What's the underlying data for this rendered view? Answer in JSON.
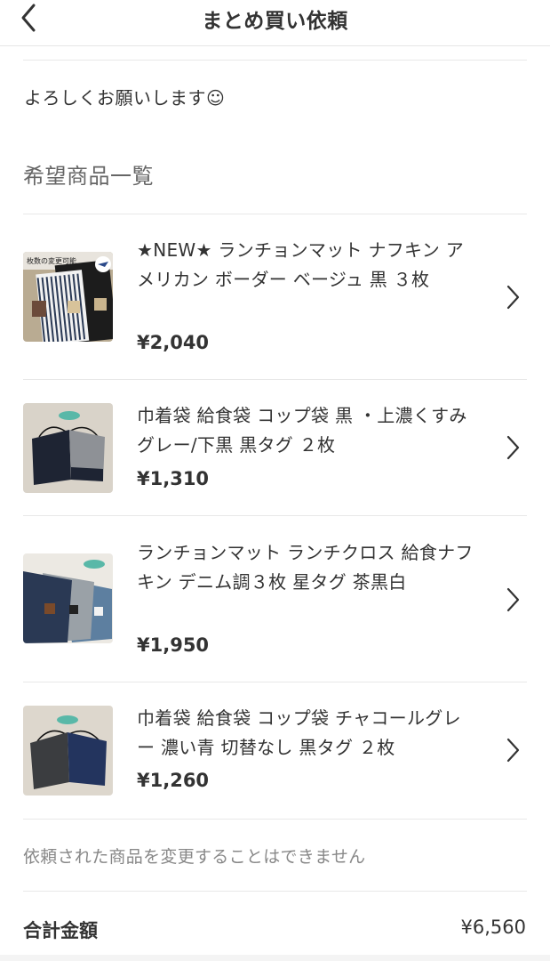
{
  "header": {
    "title": "まとめ買い依頼",
    "back_icon": "chevron-left-icon"
  },
  "message": "よろしくお願いします☺",
  "section": {
    "title": "希望商品一覧"
  },
  "items": [
    {
      "name": "★NEW★ ランチョンマット ナフキン アメリカン ボーダー ベージュ 黒 ３枚",
      "price": "¥2,040",
      "thumb_label": "枚数の変更可能"
    },
    {
      "name": "巾着袋 給食袋 コップ袋 黒 ・上濃くすみグレー/下黒 黒タグ ２枚",
      "price": "¥1,310"
    },
    {
      "name": "ランチョンマット ランチクロス 給食ナフキン デニム調３枚 星タグ 茶黒白",
      "price": "¥1,950"
    },
    {
      "name": "巾着袋 給食袋 コップ袋 チャコールグレー 濃い青 切替なし 黒タグ ２枚",
      "price": "¥1,260"
    }
  ],
  "notice": "依頼された商品を変更することはできません",
  "total": {
    "label": "合計金額",
    "value": "¥6,560"
  },
  "colors": {
    "text": "#333333",
    "muted": "#888888",
    "divider": "#e8e8e8"
  }
}
